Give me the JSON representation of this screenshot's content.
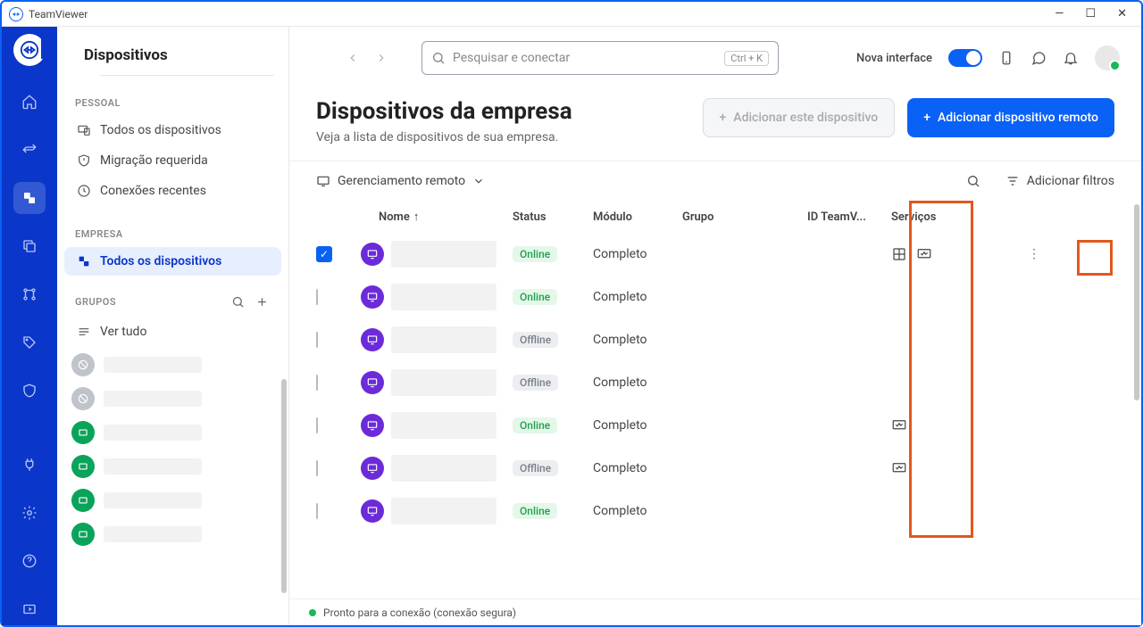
{
  "app_title": "TeamViewer",
  "sidebar": {
    "title": "Dispositivos",
    "sections": {
      "pessoal_label": "PESSOAL",
      "pessoal_items": [
        {
          "label": "Todos os dispositivos"
        },
        {
          "label": "Migração requerida"
        },
        {
          "label": "Conexões recentes"
        }
      ],
      "empresa_label": "EMPRESA",
      "empresa_items": [
        {
          "label": "Todos os dispositivos"
        }
      ],
      "grupos_label": "GRUPOS",
      "ver_tudo": "Ver tudo"
    }
  },
  "search": {
    "placeholder": "Pesquisar e conectar",
    "shortcut": "Ctrl + K"
  },
  "top": {
    "nova_interface": "Nova interface"
  },
  "page": {
    "heading": "Dispositivos da empresa",
    "subheading": "Veja a lista de dispositivos de sua empresa.",
    "btn_add_this": "Adicionar este dispositivo",
    "btn_add_remote": "Adicionar dispositivo remoto"
  },
  "toolbar": {
    "dropdown": "Gerenciamento remoto",
    "filters": "Adicionar filtros"
  },
  "table": {
    "cols": {
      "nome": "Nome",
      "status": "Status",
      "modulo": "Módulo",
      "grupo": "Grupo",
      "idtv": "ID TeamV...",
      "servicos": "Serviços"
    },
    "rows": [
      {
        "status": "Online",
        "modulo": "Completo",
        "checked": true,
        "svc": 2
      },
      {
        "status": "Online",
        "modulo": "Completo",
        "svc": 0
      },
      {
        "status": "Offline",
        "modulo": "Completo",
        "svc": 0
      },
      {
        "status": "Offline",
        "modulo": "Completo",
        "svc": 0
      },
      {
        "status": "Online",
        "modulo": "Completo",
        "svc": 1
      },
      {
        "status": "Offline",
        "modulo": "Completo",
        "svc": 1
      },
      {
        "status": "Online",
        "modulo": "Completo",
        "svc": 0
      }
    ]
  },
  "statusbar": "Pronto para a conexão (conexão segura)"
}
